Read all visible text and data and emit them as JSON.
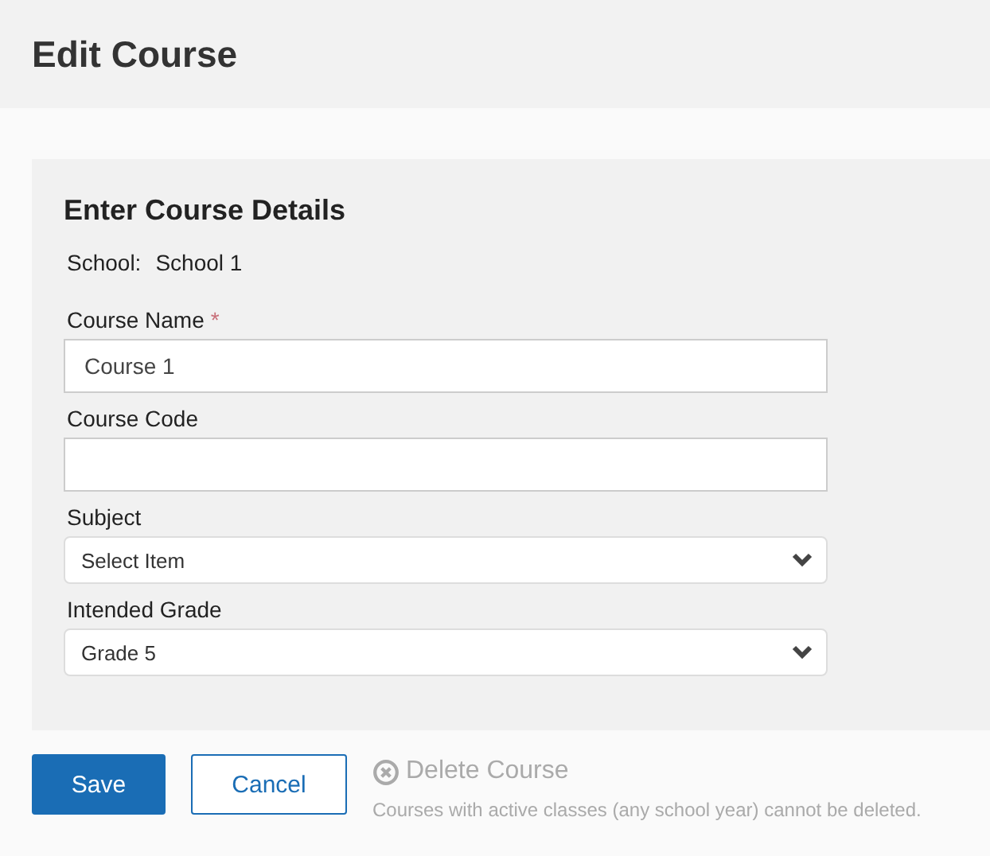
{
  "page_title": "Edit Course",
  "section_title": "Enter Course Details",
  "school": {
    "label": "School:",
    "value": "School 1"
  },
  "fields": [
    {
      "kind": "text",
      "label": "Course Name",
      "required": true,
      "value": "Course 1"
    },
    {
      "kind": "text",
      "label": "Course Code",
      "required": false
    },
    {
      "kind": "select",
      "label": "Subject",
      "required": false,
      "value": "Select Item"
    },
    {
      "kind": "select",
      "label": "Intended Grade",
      "required": false,
      "value": "Grade 5"
    }
  ],
  "required_mark": "*",
  "buttons": [
    {
      "kind": "primary",
      "label": "Save"
    },
    {
      "kind": "secondary",
      "label": "Cancel"
    }
  ],
  "delete": {
    "label": "Delete Course",
    "disabled": true,
    "note": "Courses with active classes (any school year) cannot be deleted."
  }
}
